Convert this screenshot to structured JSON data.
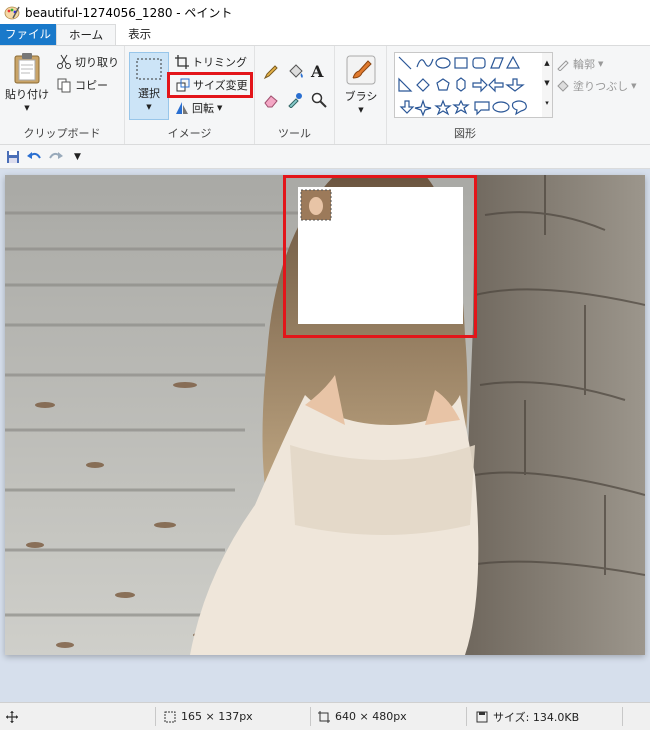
{
  "window": {
    "title": "beautiful-1274056_1280 - ペイント"
  },
  "tabs": [
    {
      "label": "ファイル"
    },
    {
      "label": "ホーム"
    },
    {
      "label": "表示"
    }
  ],
  "clipboard": {
    "paste": "貼り付け",
    "cut": "切り取り",
    "copy": "コピー",
    "group_label": "クリップボード"
  },
  "image": {
    "select": "選択",
    "crop": "トリミング",
    "resize": "サイズ変更",
    "rotate": "回転",
    "group_label": "イメージ"
  },
  "tools": {
    "group_label": "ツール"
  },
  "brush": {
    "label": "ブラシ"
  },
  "shapes": {
    "outline": "輪郭",
    "fill": "塗りつぶし",
    "group_label": "図形"
  },
  "status": {
    "selection_size": "165 × 137px",
    "image_size": "640 × 480px",
    "file_size": "サイズ: 134.0KB"
  },
  "colors": {
    "highlight": "#e3151a",
    "file_tab": "#1979ca"
  }
}
